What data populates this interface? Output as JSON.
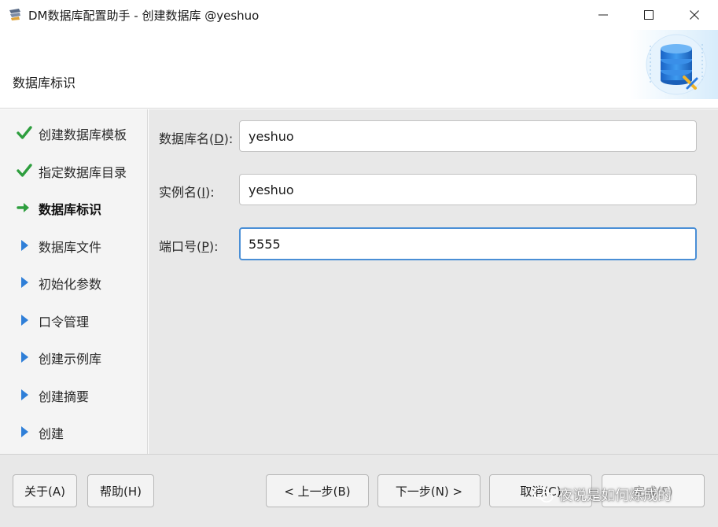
{
  "window": {
    "title": "DM数据库配置助手 - 创建数据库 @yeshuo"
  },
  "header": {
    "title": "数据库标识"
  },
  "steps": [
    {
      "label": "创建数据库模板",
      "state": "done",
      "icon": "checkmark-icon"
    },
    {
      "label": "指定数据库目录",
      "state": "done",
      "icon": "checkmark-icon"
    },
    {
      "label": "数据库标识",
      "state": "current",
      "icon": "arrow-right-icon"
    },
    {
      "label": "数据库文件",
      "state": "pending",
      "icon": "triangle-right-icon"
    },
    {
      "label": "初始化参数",
      "state": "pending",
      "icon": "triangle-right-icon"
    },
    {
      "label": "口令管理",
      "state": "pending",
      "icon": "triangle-right-icon"
    },
    {
      "label": "创建示例库",
      "state": "pending",
      "icon": "triangle-right-icon"
    },
    {
      "label": "创建摘要",
      "state": "pending",
      "icon": "triangle-right-icon"
    },
    {
      "label": "创建",
      "state": "pending",
      "icon": "triangle-right-icon"
    }
  ],
  "form": {
    "db_name": {
      "prefix": "数据库名(",
      "mnemonic": "D",
      "suffix": "):",
      "value": "yeshuo"
    },
    "instance_name": {
      "prefix": "实例名(",
      "mnemonic": "I",
      "suffix": "):",
      "value": "yeshuo"
    },
    "port": {
      "prefix": "端口号(",
      "mnemonic": "P",
      "suffix": "):",
      "value": "5555"
    }
  },
  "buttons": {
    "about": "关于(A)",
    "help": "帮助(H)",
    "prev": "< 上一步(B)",
    "next": "下一步(N) >",
    "cancel": "取消(C)",
    "finish": "完成(F)"
  },
  "watermark": {
    "text": "夜说是如何炼成的"
  },
  "colors": {
    "done_check": "#2e9e3e",
    "current_arrow": "#2e9e3e",
    "pending_triangle": "#2f7fd8",
    "focus_border": "#4a8fd6"
  }
}
